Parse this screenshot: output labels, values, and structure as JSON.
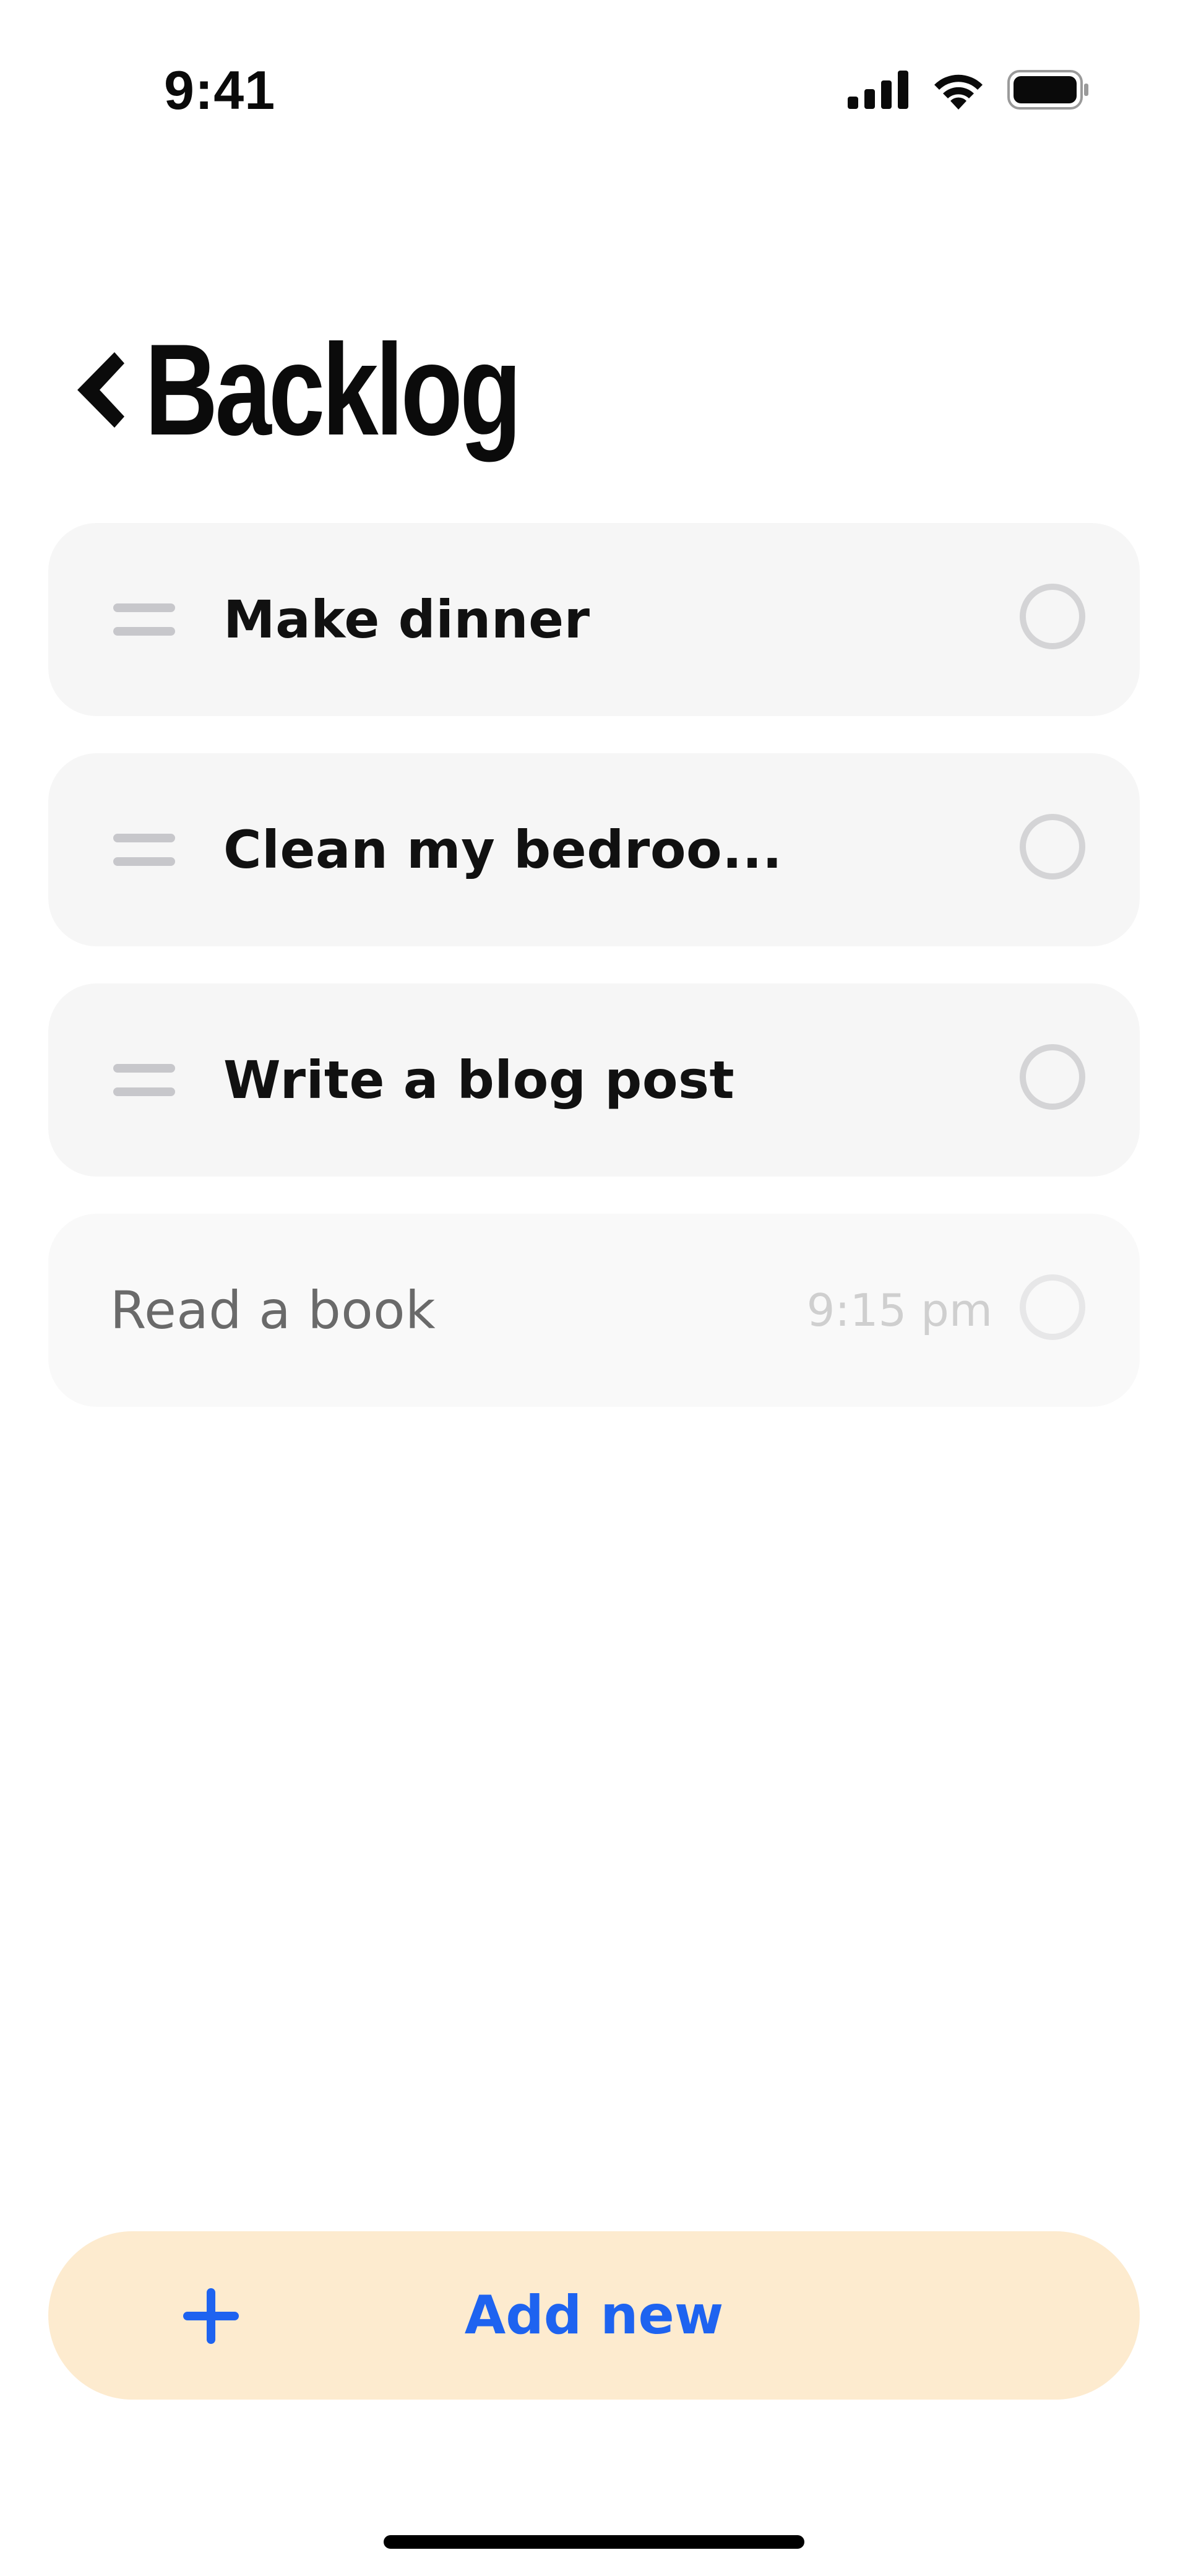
{
  "status_bar": {
    "time": "9:41",
    "icons": [
      "cellular-signal-icon",
      "wifi-icon",
      "battery-icon"
    ]
  },
  "header": {
    "back_icon": "chevron-left-icon",
    "title": "Backlog"
  },
  "tasks": [
    {
      "title": "Make dinner",
      "time": "",
      "completed": false,
      "faded": false
    },
    {
      "title": "Clean my bedroo...",
      "time": "",
      "completed": false,
      "faded": false
    },
    {
      "title": "Write a blog post",
      "time": "",
      "completed": false,
      "faded": false
    },
    {
      "title": "Read a book",
      "time": "9:15 pm",
      "completed": false,
      "faded": true
    }
  ],
  "add_button": {
    "icon": "plus-icon",
    "label": "Add new"
  },
  "colors": {
    "accent": "#1e63f0",
    "add_button_background": "#fdebcf",
    "card_background": "#f6f6f6",
    "drag_handle": "#c7c7cb",
    "checkbox_border": "#d4d4d6"
  }
}
